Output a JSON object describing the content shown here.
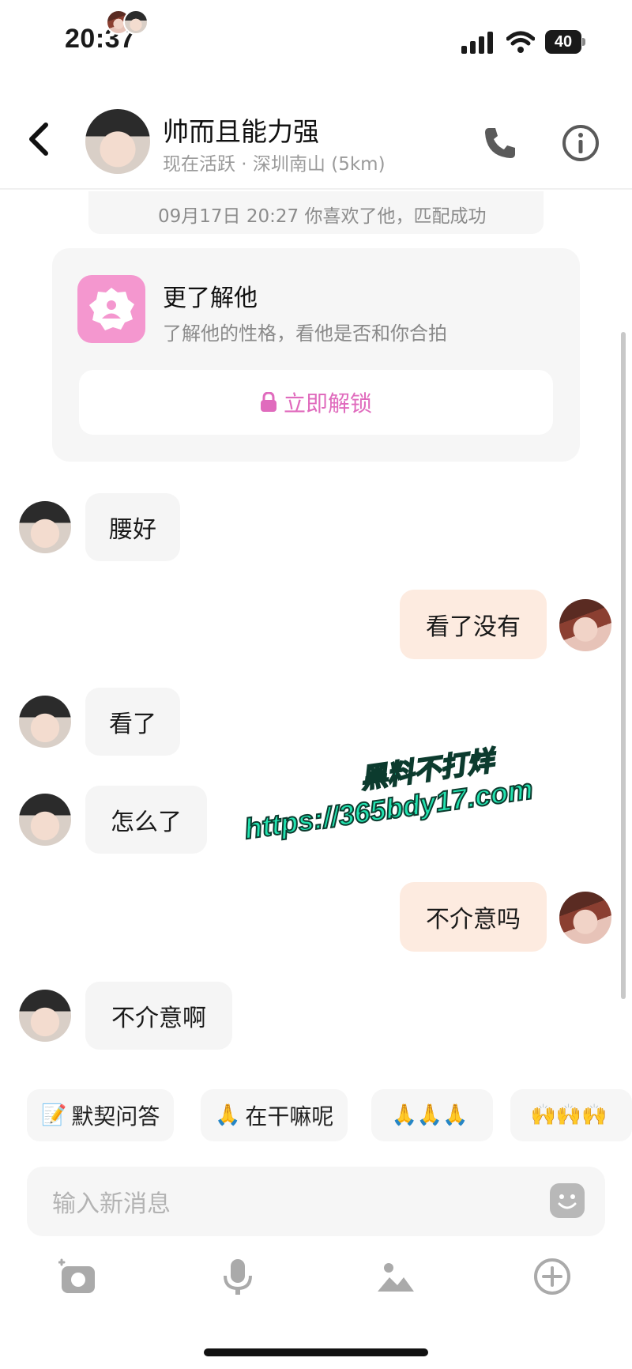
{
  "status_bar": {
    "time": "20:37",
    "battery": "40"
  },
  "header": {
    "name": "帅而且能力强",
    "status": "现在活跃 · 深圳南山 (5km)",
    "icons": [
      "back-arrow-icon",
      "phone-icon",
      "info-icon"
    ]
  },
  "match_banner": {
    "text": "09月17日 20:27 你喜欢了他，匹配成功"
  },
  "know_card": {
    "title": "更了解他",
    "desc": "了解他的性格，看他是否和你合拍",
    "unlock_label": "立即解锁"
  },
  "messages": [
    {
      "from": "them",
      "text": "腰好"
    },
    {
      "from": "me",
      "text": "看了没有"
    },
    {
      "from": "them",
      "text": "看了"
    },
    {
      "from": "them",
      "text": "怎么了"
    },
    {
      "from": "me",
      "text": "不介意吗"
    },
    {
      "from": "them",
      "text": "不介意啊"
    }
  ],
  "watermark": {
    "line1": "黑料不打烊",
    "line2": "https://365bdy17.com"
  },
  "quick_replies": [
    {
      "emoji": "📝",
      "label": "默契问答"
    },
    {
      "emoji": "🙏",
      "label": "在干嘛呢"
    },
    {
      "emoji": "🙏🙏🙏",
      "label": ""
    },
    {
      "emoji": "🙌🙌🙌",
      "label": ""
    }
  ],
  "input": {
    "placeholder": "输入新消息"
  },
  "toolbar": [
    "camera-icon",
    "microphone-icon",
    "image-icon",
    "plus-icon"
  ],
  "colors": {
    "accent_pink": "#f497cf",
    "outgoing_bubble": "#fdebe0",
    "incoming_bubble": "#f5f5f5"
  }
}
